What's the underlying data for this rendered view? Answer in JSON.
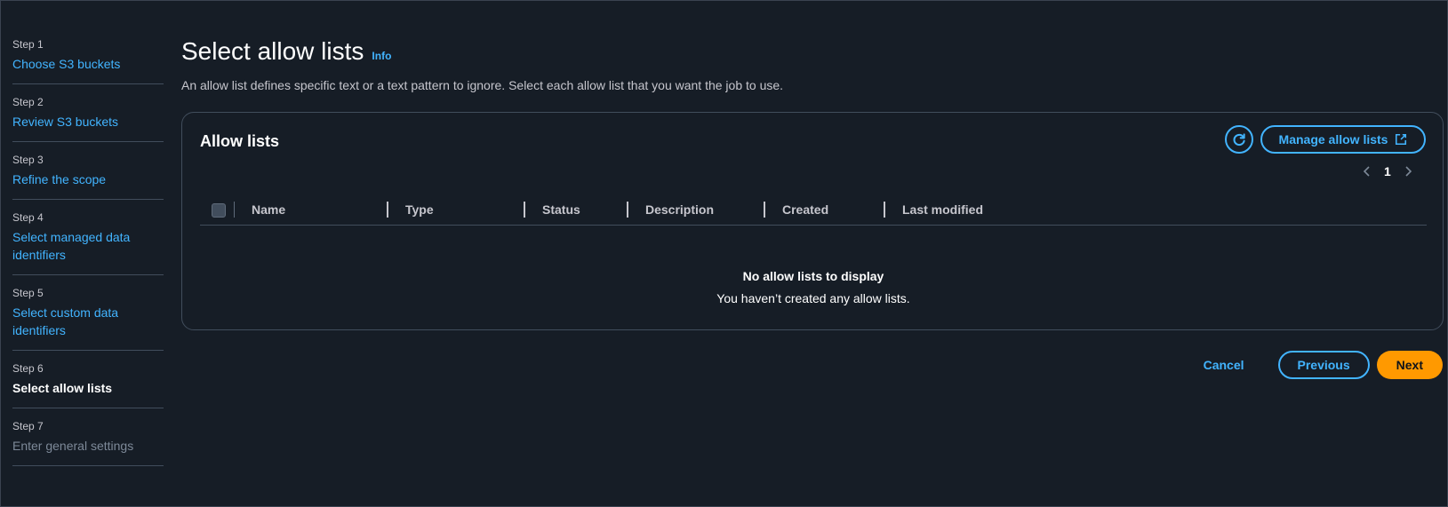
{
  "steps": [
    {
      "num": "Step 1",
      "title": "Choose S3 buckets",
      "state": "link"
    },
    {
      "num": "Step 2",
      "title": "Review S3 buckets",
      "state": "link"
    },
    {
      "num": "Step 3",
      "title": "Refine the scope",
      "state": "link"
    },
    {
      "num": "Step 4",
      "title": "Select managed data identifiers",
      "state": "link"
    },
    {
      "num": "Step 5",
      "title": "Select custom data identifiers",
      "state": "link"
    },
    {
      "num": "Step 6",
      "title": "Select allow lists",
      "state": "current"
    },
    {
      "num": "Step 7",
      "title": "Enter general settings",
      "state": "disabled"
    }
  ],
  "page": {
    "title": "Select allow lists",
    "info_label": "Info",
    "description": "An allow list defines specific text or a text pattern to ignore. Select each allow list that you want the job to use."
  },
  "allow_lists": {
    "title": "Allow lists",
    "refresh_icon": "refresh-icon",
    "manage_label": "Manage allow lists",
    "manage_icon": "external-link-icon",
    "pagination": {
      "current_page": "1"
    },
    "columns": [
      "Name",
      "Type",
      "Status",
      "Description",
      "Created",
      "Last modified"
    ],
    "empty_title": "No allow lists to display",
    "empty_desc": "You haven’t created any allow lists."
  },
  "actions": {
    "cancel": "Cancel",
    "previous": "Previous",
    "next": "Next"
  },
  "colors": {
    "background": "#161d26",
    "link": "#42b4ff",
    "primary": "#ff9900",
    "border": "#414d5c"
  }
}
